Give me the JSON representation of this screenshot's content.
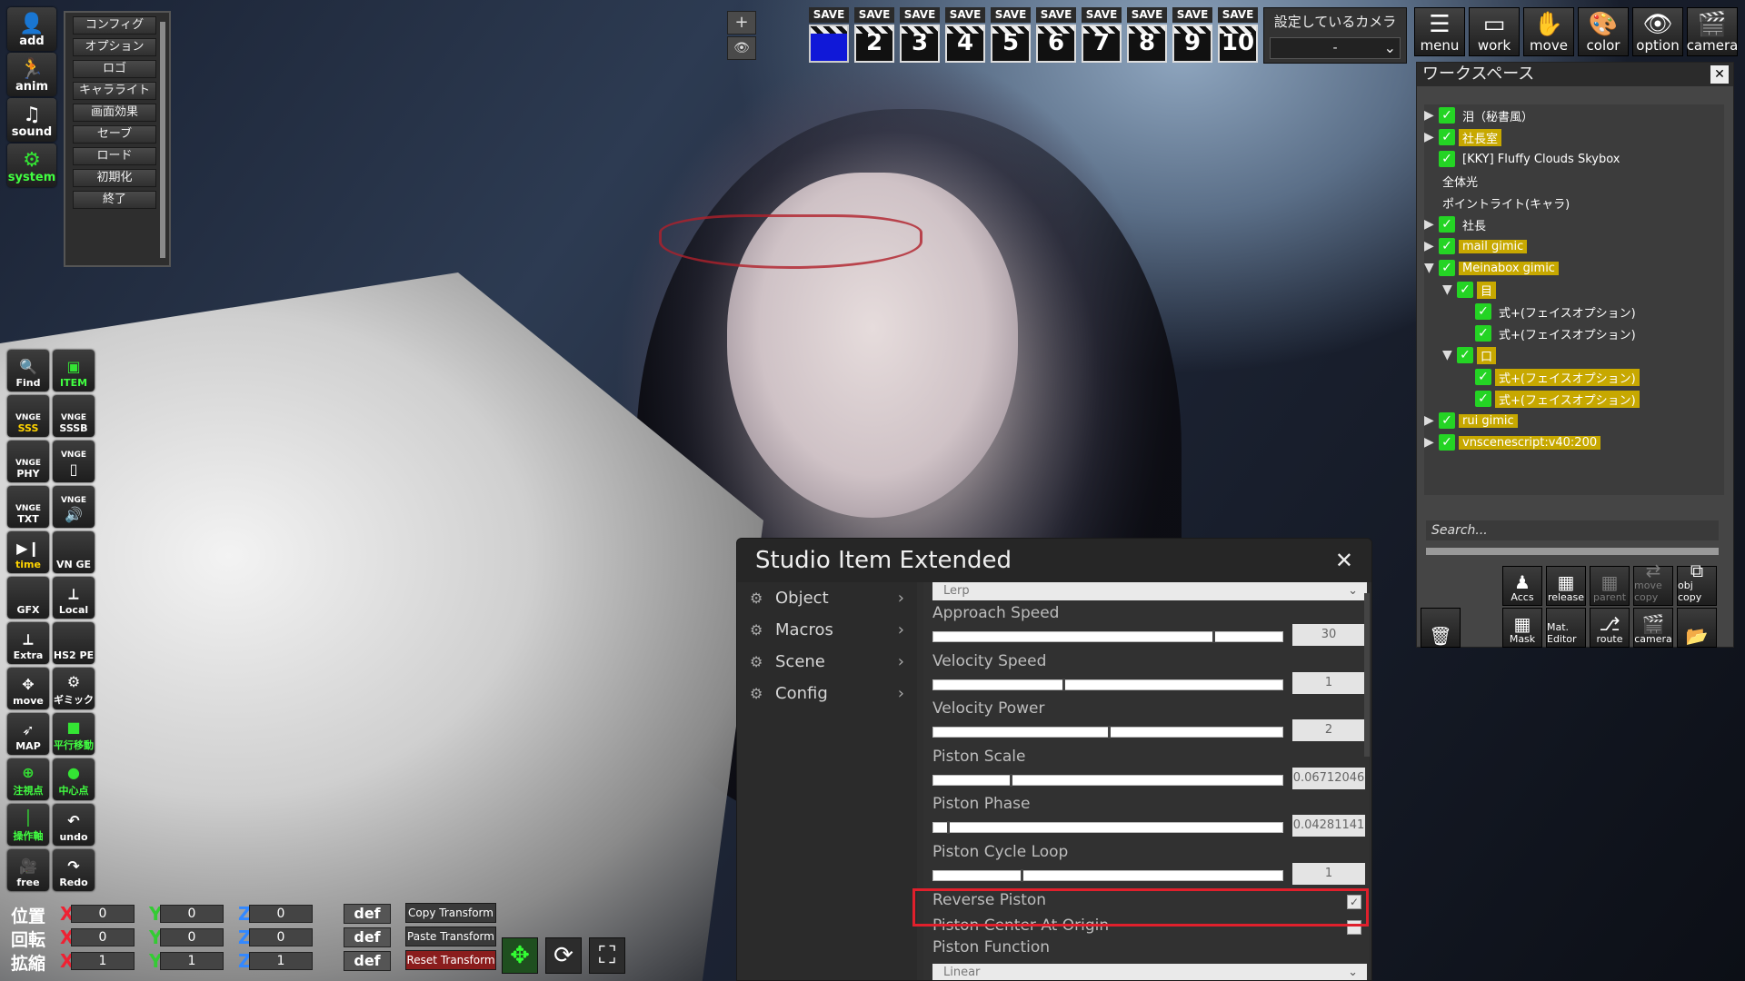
{
  "left_toolbar": {
    "main": [
      {
        "label": "add",
        "icon": "person-add-icon"
      },
      {
        "label": "anim",
        "icon": "running-person-icon"
      },
      {
        "label": "sound",
        "icon": "music-note-icon"
      },
      {
        "label": "system",
        "icon": "gears-icon"
      }
    ],
    "tools": [
      {
        "label": "Find",
        "icon": "magnifier-icon"
      },
      {
        "label": "ITEM",
        "icon": "item-icon"
      },
      {
        "label": "SSS",
        "sub": "VNGE",
        "icon": "vnge-sss-icon"
      },
      {
        "label": "SSSB",
        "sub": "VNGE",
        "icon": "vnge-sssb-icon"
      },
      {
        "label": "PHY",
        "sub": "VNGE",
        "icon": "vnge-phy-icon"
      },
      {
        "label": "",
        "sub": "VNGE",
        "icon": "vnge-book-icon"
      },
      {
        "label": "TXT",
        "sub": "VNGE",
        "icon": "vnge-txt-icon"
      },
      {
        "label": "",
        "sub": "VNGE",
        "icon": "vnge-speaker-icon"
      },
      {
        "label": "time",
        "icon": "time-play-icon"
      },
      {
        "label": "VN GE",
        "icon": "vnge-icon"
      },
      {
        "label": "GFX",
        "icon": "gfx-icon"
      },
      {
        "label": "Local",
        "icon": "local-axis-icon"
      },
      {
        "label": "Extra",
        "icon": "extra-axis-icon"
      },
      {
        "label": "HS2 PE",
        "icon": "hs2pe-icon"
      },
      {
        "label": "move",
        "icon": "move-arrows-icon"
      },
      {
        "label": "ギミック",
        "icon": "gimmick-gear-icon"
      },
      {
        "label": "MAP",
        "icon": "map-icon"
      },
      {
        "label": "平行移動",
        "icon": "parallel-move-icon"
      },
      {
        "label": "注視点",
        "icon": "focus-point-icon"
      },
      {
        "label": "中心点",
        "icon": "center-point-icon"
      },
      {
        "label": "操作軸",
        "icon": "control-axis-icon"
      },
      {
        "label": "undo",
        "icon": "undo-icon"
      },
      {
        "label": "free",
        "icon": "free-camera-icon"
      },
      {
        "label": "Redo",
        "icon": "redo-icon"
      }
    ]
  },
  "system_menu": [
    "コンフィグ",
    "オプション",
    "ロゴ",
    "キャラライト",
    "画面効果",
    "セーブ",
    "ロード",
    "初期化",
    "終了"
  ],
  "top_controls": {
    "plus": "+",
    "eye": "👁"
  },
  "save_slots": [
    {
      "label": "SAVE",
      "num": ""
    },
    {
      "label": "SAVE",
      "num": "2"
    },
    {
      "label": "SAVE",
      "num": "3"
    },
    {
      "label": "SAVE",
      "num": "4"
    },
    {
      "label": "SAVE",
      "num": "5"
    },
    {
      "label": "SAVE",
      "num": "6"
    },
    {
      "label": "SAVE",
      "num": "7"
    },
    {
      "label": "SAVE",
      "num": "8"
    },
    {
      "label": "SAVE",
      "num": "9"
    },
    {
      "label": "SAVE",
      "num": "10"
    }
  ],
  "camera_select": {
    "title": "設定しているカメラ",
    "value": "-"
  },
  "right_toolbar": [
    {
      "label": "menu",
      "icon": "menu-list-icon"
    },
    {
      "label": "work",
      "icon": "work-frame-icon"
    },
    {
      "label": "move",
      "icon": "hand-icon"
    },
    {
      "label": "color",
      "icon": "palette-icon"
    },
    {
      "label": "option",
      "icon": "eye-icon"
    },
    {
      "label": "camera",
      "icon": "clapper-icon"
    }
  ],
  "workspace": {
    "title": "ワークスペース",
    "search_placeholder": "Search...",
    "tree": [
      {
        "text": "泪（秘書風）",
        "level": 0,
        "expand": "right",
        "checked": true,
        "hl": false
      },
      {
        "text": "社長室",
        "level": 0,
        "expand": "right",
        "checked": true,
        "hl": true
      },
      {
        "text": "[KKY] Fluffy Clouds Skybox",
        "level": 0,
        "expand": "none",
        "checked": true,
        "hl": false
      },
      {
        "text": "全体光",
        "level": 0,
        "expand": "none",
        "checked": false,
        "hl": false
      },
      {
        "text": "ポイントライト(キャラ)",
        "level": 0,
        "expand": "none",
        "checked": false,
        "hl": false
      },
      {
        "text": "社長",
        "level": 0,
        "expand": "right",
        "checked": true,
        "hl": false
      },
      {
        "text": "mail gimic",
        "level": 0,
        "expand": "right",
        "checked": true,
        "hl": true
      },
      {
        "text": "Meinabox gimic",
        "level": 0,
        "expand": "down",
        "checked": true,
        "hl": true
      },
      {
        "text": "目",
        "level": 1,
        "expand": "down",
        "checked": true,
        "hl": true
      },
      {
        "text": "式+(フェイスオプション)",
        "level": 2,
        "expand": "none",
        "checked": true,
        "hl": false
      },
      {
        "text": "式+(フェイスオプション)",
        "level": 2,
        "expand": "none",
        "checked": true,
        "hl": false
      },
      {
        "text": "口",
        "level": 1,
        "expand": "down",
        "checked": true,
        "hl": true
      },
      {
        "text": "式+(フェイスオプション)",
        "level": 2,
        "expand": "none",
        "checked": true,
        "hl": true
      },
      {
        "text": "式+(フェイスオプション)",
        "level": 2,
        "expand": "none",
        "checked": true,
        "hl": true
      },
      {
        "text": "rui gimic",
        "level": 0,
        "expand": "right",
        "checked": true,
        "hl": true
      },
      {
        "text": "vnscenescript:v40:200",
        "level": 0,
        "expand": "right",
        "checked": true,
        "hl": true
      }
    ],
    "buttons_row1": [
      {
        "label": "Accs",
        "icon": "accs-icon",
        "dim": false
      },
      {
        "label": "release",
        "icon": "release-icon",
        "dim": false
      },
      {
        "label": "parent",
        "icon": "parent-icon",
        "dim": true
      },
      {
        "label": "move copy",
        "icon": "move-copy-icon",
        "dim": true
      },
      {
        "label": "obj copy",
        "icon": "obj-copy-icon",
        "dim": false
      }
    ],
    "buttons_row2": [
      {
        "label": "",
        "icon": "trash-icon",
        "dim": false
      },
      {
        "label": "Mask",
        "icon": "mask-icon",
        "dim": false
      },
      {
        "label": "Mat. Editor",
        "icon": "mat-editor-icon",
        "dim": false
      },
      {
        "label": "route",
        "icon": "route-icon",
        "dim": false
      },
      {
        "label": "camera",
        "icon": "camera-icon",
        "dim": false
      },
      {
        "label": "",
        "icon": "folder-icon",
        "dim": false
      }
    ]
  },
  "sie": {
    "title": "Studio Item Extended",
    "close": "✕",
    "nav": [
      "Object",
      "Macros",
      "Scene",
      "Config"
    ],
    "dropdown": "Lerp",
    "sliders": [
      {
        "label": "Approach Speed",
        "value": "30",
        "pct": 0.8
      },
      {
        "label": "Velocity Speed",
        "value": "1",
        "pct": 0.37
      },
      {
        "label": "Velocity Power",
        "value": "2",
        "pct": 0.5
      },
      {
        "label": "Piston Scale",
        "value": "0.06712046",
        "pct": 0.22
      },
      {
        "label": "Piston Phase",
        "value": "0.04281141",
        "pct": 0.04
      },
      {
        "label": "Piston Cycle Loop",
        "value": "1",
        "pct": 0.25
      }
    ],
    "checks": [
      {
        "label": "Reverse Piston",
        "checked": true
      },
      {
        "label": "Piston Center At Origin",
        "checked": false
      }
    ],
    "function_label": "Piston Function",
    "function_value": "Linear"
  },
  "transform": {
    "rows": [
      {
        "label": "位置",
        "x": "0",
        "y": "0",
        "z": "0"
      },
      {
        "label": "回転",
        "x": "0",
        "y": "0",
        "z": "0"
      },
      {
        "label": "拡縮",
        "x": "1",
        "y": "1",
        "z": "1"
      }
    ],
    "axes": {
      "x": "X",
      "y": "Y",
      "z": "Z"
    },
    "def": "def",
    "copy": "Copy Transform",
    "paste": "Paste Transform",
    "reset": "Reset Transform"
  }
}
